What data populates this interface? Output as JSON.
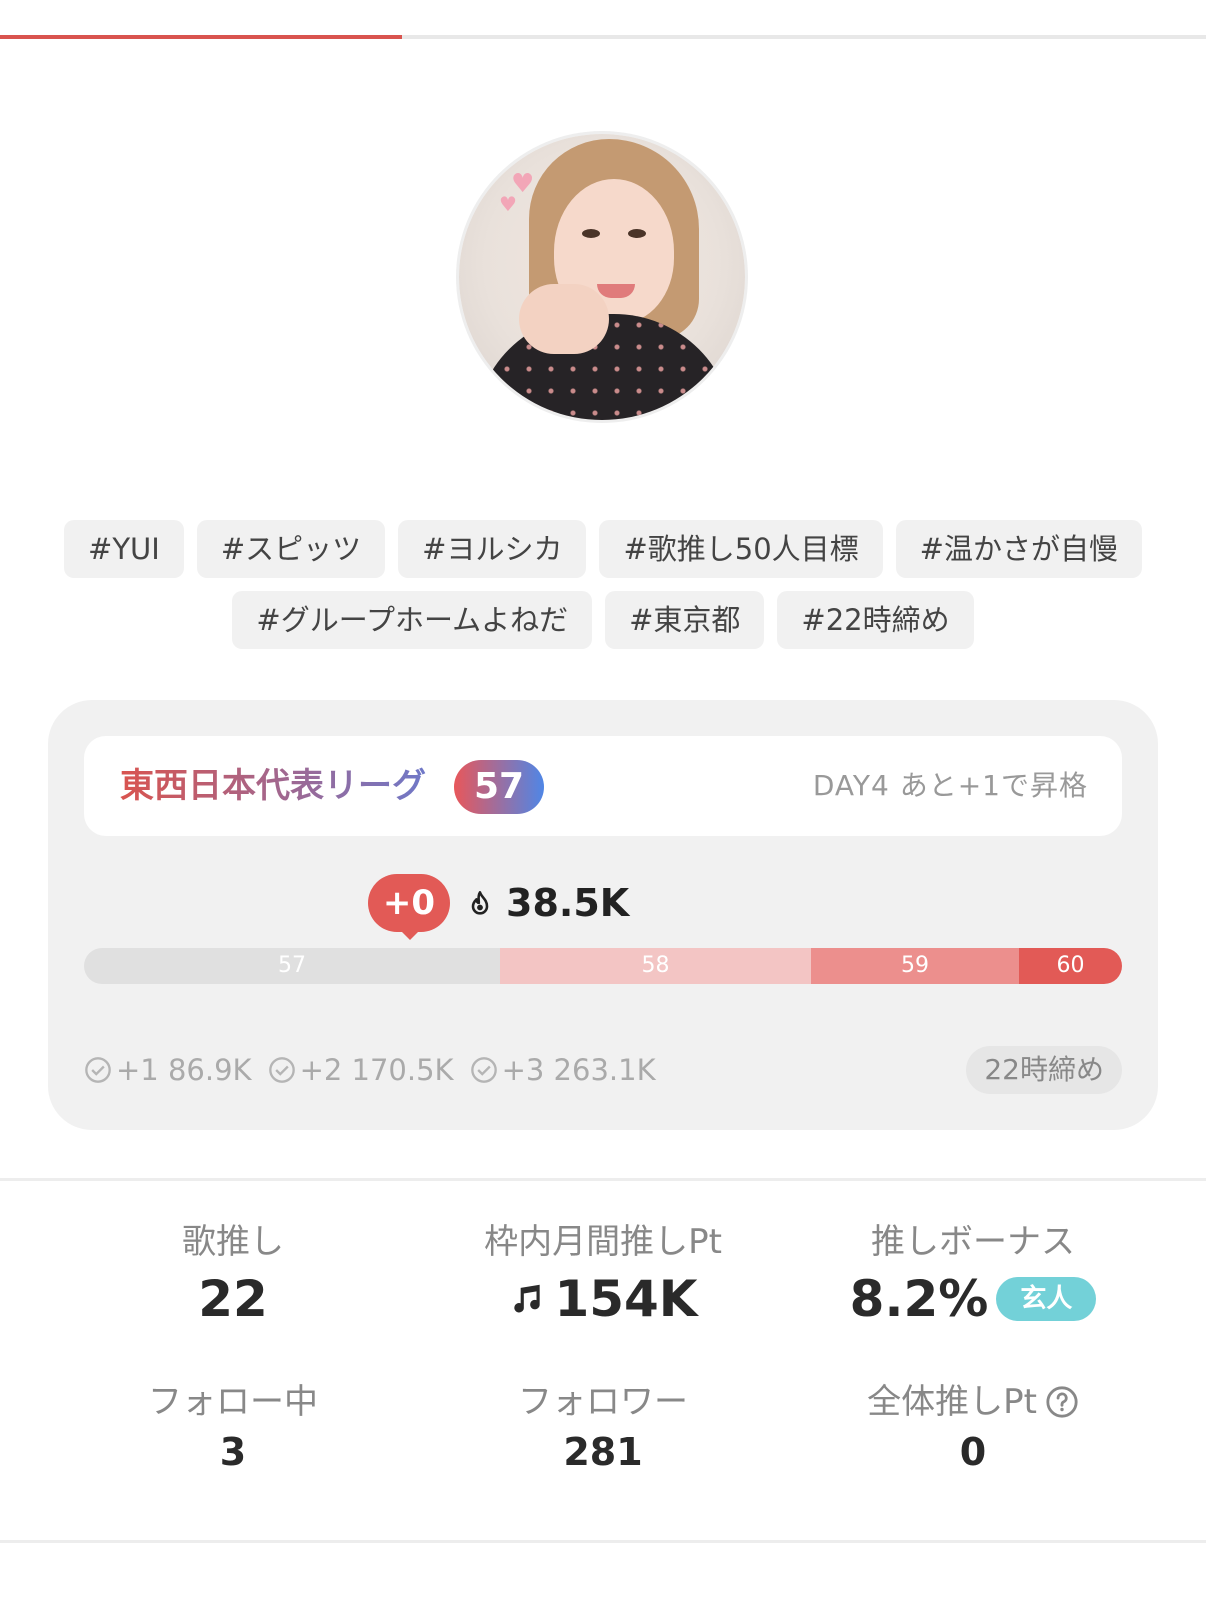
{
  "top_progress": {
    "fraction": 0.333
  },
  "tags": [
    [
      "#YUI",
      "#スピッツ",
      "#ヨルシカ",
      "#歌推し50人目標",
      "#温かさが自慢"
    ],
    [
      "#グループホームよねだ",
      "#東京都",
      "#22時締め"
    ]
  ],
  "league": {
    "name": "東西日本代表リーグ",
    "rank": "57",
    "status": "DAY4 あと+1で昇格",
    "delta": "+0",
    "points": "38.5K",
    "segments": [
      "57",
      "58",
      "59",
      "60"
    ],
    "thresholds": [
      "+1 86.9K",
      "+2 170.5K",
      "+3 263.1K"
    ],
    "deadline": "22時締め"
  },
  "stats": {
    "uta_oshi": {
      "label": "歌推し",
      "value": "22"
    },
    "monthly_pt": {
      "label": "枠内月間推しPt",
      "value": "154K"
    },
    "bonus": {
      "label": "推しボーナス",
      "value": "8.2%",
      "badge": "玄人"
    },
    "following": {
      "label": "フォロー中",
      "value": "3"
    },
    "followers": {
      "label": "フォロワー",
      "value": "281"
    },
    "total_pt": {
      "label": "全体推しPt",
      "value": "0"
    }
  },
  "colors": {
    "accent": "#d9544f",
    "badge": "#73d1d8"
  }
}
